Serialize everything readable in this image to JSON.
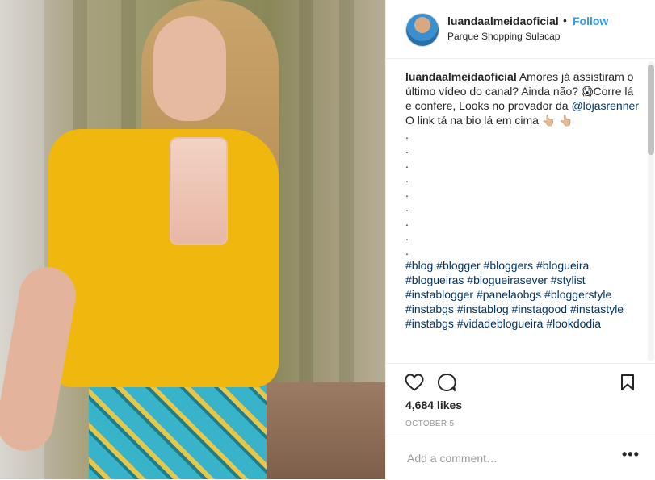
{
  "post": {
    "username": "luandaalmeidaoficial",
    "dot": "•",
    "follow_label": "Follow",
    "location": "Parque Shopping Sulacap"
  },
  "caption": {
    "username": "luandaalmeidaoficial",
    "line1": " Amores já assistiram o último vídeo do canal? Ainda não? 😱Corre lá e confere, Looks no provador da ",
    "mention": "@lojasrenner",
    "line2": "O link tá na bio lá em cima 👆🏼 👆🏼",
    "dots": [
      ".",
      ".",
      ".",
      ".",
      ".",
      ".",
      ".",
      ".",
      "."
    ],
    "hashtags": [
      "#blog",
      "#blogger",
      "#bloggers",
      "#blogueira",
      "#blogueiras",
      "#blogueirasever",
      "#stylist",
      "#instablogger",
      "#panelaobgs",
      "#bloggerstyle",
      "#instabgs",
      "#instablog",
      "#instagood",
      "#instastyle",
      "#instabgs",
      "#vidadeblogueira",
      "#lookdodia"
    ]
  },
  "icons": {
    "like": "heart-icon",
    "comment": "comment-icon",
    "save": "bookmark-icon",
    "more": "more-options-icon"
  },
  "stats": {
    "likes": "4,684 likes",
    "date": "OCTOBER 5"
  },
  "comment": {
    "placeholder": "Add a comment…",
    "more_label": "•••"
  }
}
